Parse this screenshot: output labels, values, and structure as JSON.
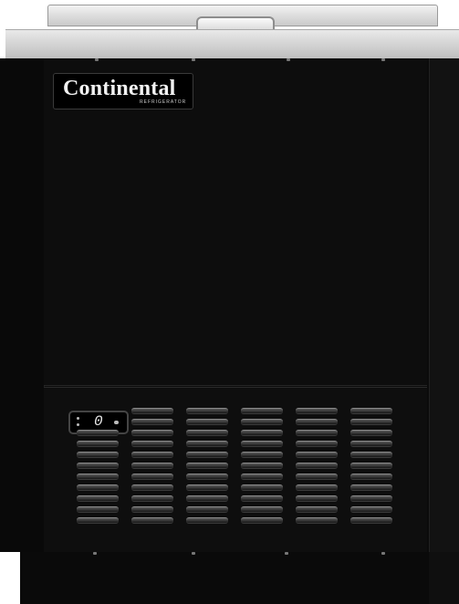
{
  "product": {
    "brand_name": "Continental",
    "brand_subtitle": "REFRIGERATOR",
    "thermostat_display": "0"
  },
  "colors": {
    "cabinet": "#0b0b0b",
    "stainless": "#d6d6d6",
    "badge_text": "#f2f2f2"
  }
}
